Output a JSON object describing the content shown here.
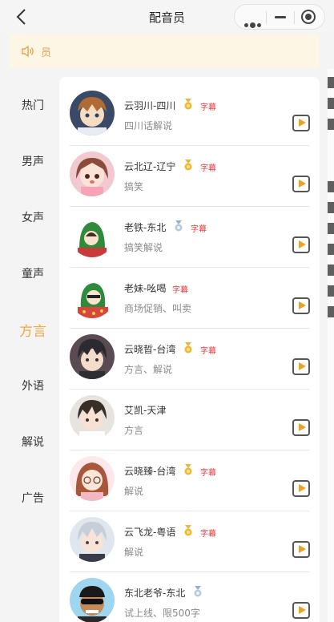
{
  "header": {
    "title": "配音员"
  },
  "notice": {
    "text": "员"
  },
  "categories": [
    {
      "label": "热门"
    },
    {
      "label": "男声"
    },
    {
      "label": "女声"
    },
    {
      "label": "童声"
    },
    {
      "label": "方言",
      "active": true
    },
    {
      "label": "外语"
    },
    {
      "label": "解说"
    },
    {
      "label": "广告"
    }
  ],
  "voices": [
    {
      "name": "云羽川-四川",
      "desc": "四川话解说",
      "medal": "gold",
      "subtitle_tag": "字幕"
    },
    {
      "name": "云北辽-辽宁",
      "desc": "搞笑",
      "medal": "gold",
      "subtitle_tag": "字幕"
    },
    {
      "name": "老铁-东北",
      "desc": "搞笑解说",
      "medal": "silver",
      "subtitle_tag": "字幕"
    },
    {
      "name": "老妹-吆喝",
      "desc": "商场促销、叫卖",
      "medal": "",
      "subtitle_tag": "字幕"
    },
    {
      "name": "云晓晢-台湾",
      "desc": "方言、解说",
      "medal": "gold",
      "subtitle_tag": "字幕"
    },
    {
      "name": "艾凯-天津",
      "desc": "方言",
      "medal": "",
      "subtitle_tag": ""
    },
    {
      "name": "云晓臻-台湾",
      "desc": "解说",
      "medal": "gold",
      "subtitle_tag": "字幕"
    },
    {
      "name": "云飞龙-粤语",
      "desc": "解说",
      "medal": "gold",
      "subtitle_tag": "字幕"
    },
    {
      "name": "东北老爷-东北",
      "desc": "试上线、限500字",
      "medal": "silver",
      "subtitle_tag": ""
    }
  ],
  "colors": {
    "accent": "#f0a641",
    "tag": "#e23a3a",
    "notice_bg": "#fdf6e4"
  }
}
